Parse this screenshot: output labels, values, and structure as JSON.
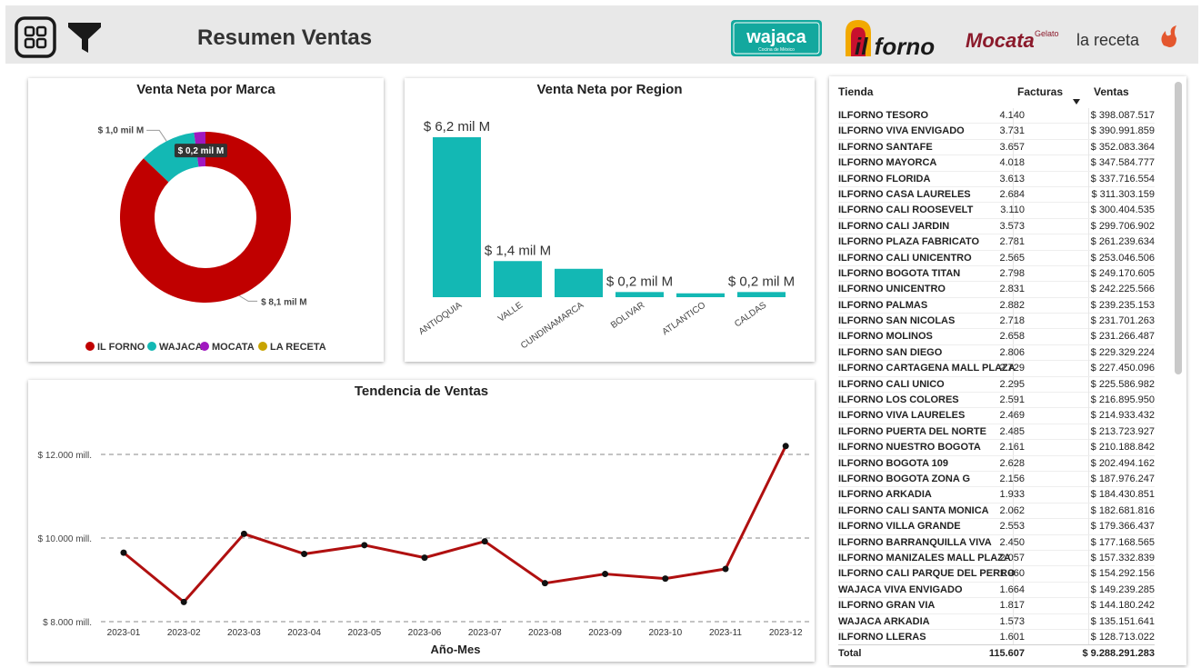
{
  "header": {
    "title": "Resumen Ventas",
    "brands": [
      {
        "name": "wajaca",
        "tagline": "Cocina de México",
        "color": "#13a89e"
      },
      {
        "name": "il forno",
        "color": "#c8102e"
      },
      {
        "name": "Mocata",
        "tag": "Gelato",
        "color": "#8b1a2b"
      },
      {
        "name": "la receta",
        "color": "#333333"
      }
    ]
  },
  "colors": {
    "il_forno": "#c00000",
    "wajaca": "#13b8b4",
    "mocata": "#a018c0",
    "la_receta": "#c8a400",
    "line": "#b01010",
    "bar": "#13b8b4"
  },
  "brand_chart": {
    "title": "Venta Neta por Marca",
    "labels": {
      "big": "$ 8,1 mil M",
      "wajaca": "$ 1,0 mil M",
      "mocata": "$ 0,2 mil M"
    },
    "legend": [
      "IL FORNO",
      "WAJACA",
      "MOCATA",
      "LA RECETA"
    ]
  },
  "region_chart": {
    "title": "Venta Neta por Region"
  },
  "trend_chart": {
    "title": "Tendencia de Ventas",
    "xlabel": "Año-Mes",
    "yticks": [
      "$ 12.000 mill.",
      "$ 10.000 mill.",
      "$ 8.000 mill."
    ]
  },
  "chart_data": [
    {
      "type": "pie",
      "title": "Venta Neta por Marca",
      "categories": [
        "IL FORNO",
        "WAJACA",
        "MOCATA",
        "LA RECETA"
      ],
      "values": [
        8.1,
        1.0,
        0.2,
        0.0
      ],
      "unit": "mil M",
      "legend": "bottom"
    },
    {
      "type": "bar",
      "title": "Venta Neta por Region",
      "categories": [
        "ANTIOQUIA",
        "VALLE",
        "CUNDINAMARCA",
        "BOLIVAR",
        "ATLANTICO",
        "CALDAS"
      ],
      "values": [
        6.2,
        1.4,
        1.1,
        0.2,
        0.15,
        0.2
      ],
      "data_labels": [
        "$ 6,2 mil M",
        "$ 1,4 mil M",
        "",
        "$ 0,2 mil M",
        "",
        "$ 0,2 mil M"
      ],
      "unit": "mil M"
    },
    {
      "type": "line",
      "title": "Tendencia de Ventas",
      "xlabel": "Año-Mes",
      "x": [
        "2023-01",
        "2023-02",
        "2023-03",
        "2023-04",
        "2023-05",
        "2023-06",
        "2023-07",
        "2023-08",
        "2023-09",
        "2023-10",
        "2023-11",
        "2023-12"
      ],
      "values": [
        9650,
        8470,
        10100,
        9620,
        9830,
        9530,
        9920,
        8920,
        9140,
        9030,
        9260,
        12200
      ],
      "unit": "mill.",
      "ylim": [
        8000,
        12600
      ],
      "grid": true
    }
  ],
  "table": {
    "headers": {
      "tienda": "Tienda",
      "facturas": "Facturas",
      "ventas": "Ventas"
    },
    "rows": [
      [
        "ILFORNO TESORO",
        "4.140",
        "$ 398.087.517"
      ],
      [
        "ILFORNO VIVA ENVIGADO",
        "3.731",
        "$ 390.991.859"
      ],
      [
        "ILFORNO SANTAFE",
        "3.657",
        "$ 352.083.364"
      ],
      [
        "ILFORNO MAYORCA",
        "4.018",
        "$ 347.584.777"
      ],
      [
        "ILFORNO FLORIDA",
        "3.613",
        "$ 337.716.554"
      ],
      [
        "ILFORNO CASA LAURELES",
        "2.684",
        "$ 311.303.159"
      ],
      [
        "ILFORNO CALI ROOSEVELT",
        "3.110",
        "$ 300.404.535"
      ],
      [
        "ILFORNO CALI JARDIN",
        "3.573",
        "$ 299.706.902"
      ],
      [
        "ILFORNO PLAZA FABRICATO",
        "2.781",
        "$ 261.239.634"
      ],
      [
        "ILFORNO CALI UNICENTRO",
        "2.565",
        "$ 253.046.506"
      ],
      [
        "ILFORNO BOGOTA TITAN",
        "2.798",
        "$ 249.170.605"
      ],
      [
        "ILFORNO UNICENTRO",
        "2.831",
        "$ 242.225.566"
      ],
      [
        "ILFORNO PALMAS",
        "2.882",
        "$ 239.235.153"
      ],
      [
        "ILFORNO SAN NICOLAS",
        "2.718",
        "$ 231.701.263"
      ],
      [
        "ILFORNO MOLINOS",
        "2.658",
        "$ 231.266.487"
      ],
      [
        "ILFORNO SAN DIEGO",
        "2.806",
        "$ 229.329.224"
      ],
      [
        "ILFORNO CARTAGENA MALL PLAZA",
        "2.729",
        "$ 227.450.096"
      ],
      [
        "ILFORNO CALI UNICO",
        "2.295",
        "$ 225.586.982"
      ],
      [
        "ILFORNO LOS COLORES",
        "2.591",
        "$ 216.895.950"
      ],
      [
        "ILFORNO VIVA LAURELES",
        "2.469",
        "$ 214.933.432"
      ],
      [
        "ILFORNO PUERTA DEL NORTE",
        "2.485",
        "$ 213.723.927"
      ],
      [
        "ILFORNO NUESTRO BOGOTA",
        "2.161",
        "$ 210.188.842"
      ],
      [
        "ILFORNO BOGOTA 109",
        "2.628",
        "$ 202.494.162"
      ],
      [
        "ILFORNO BOGOTA ZONA G",
        "2.156",
        "$ 187.976.247"
      ],
      [
        "ILFORNO ARKADIA",
        "1.933",
        "$ 184.430.851"
      ],
      [
        "ILFORNO CALI SANTA MONICA",
        "2.062",
        "$ 182.681.816"
      ],
      [
        "ILFORNO VILLA GRANDE",
        "2.553",
        "$ 179.366.437"
      ],
      [
        "ILFORNO BARRANQUILLA VIVA",
        "2.450",
        "$ 177.168.565"
      ],
      [
        "ILFORNO MANIZALES MALL PLAZA",
        "2.057",
        "$ 157.332.839"
      ],
      [
        "ILFORNO CALI PARQUE DEL PERRO",
        "1.960",
        "$ 154.292.156"
      ],
      [
        "WAJACA VIVA ENVIGADO",
        "1.664",
        "$ 149.239.285"
      ],
      [
        "ILFORNO GRAN VIA",
        "1.817",
        "$ 144.180.242"
      ],
      [
        "WAJACA ARKADIA",
        "1.573",
        "$ 135.151.641"
      ],
      [
        "ILFORNO LLERAS",
        "1.601",
        "$ 128.713.022"
      ]
    ],
    "total": {
      "label": "Total",
      "facturas": "115.607",
      "ventas": "$ 9.288.291.283"
    }
  }
}
